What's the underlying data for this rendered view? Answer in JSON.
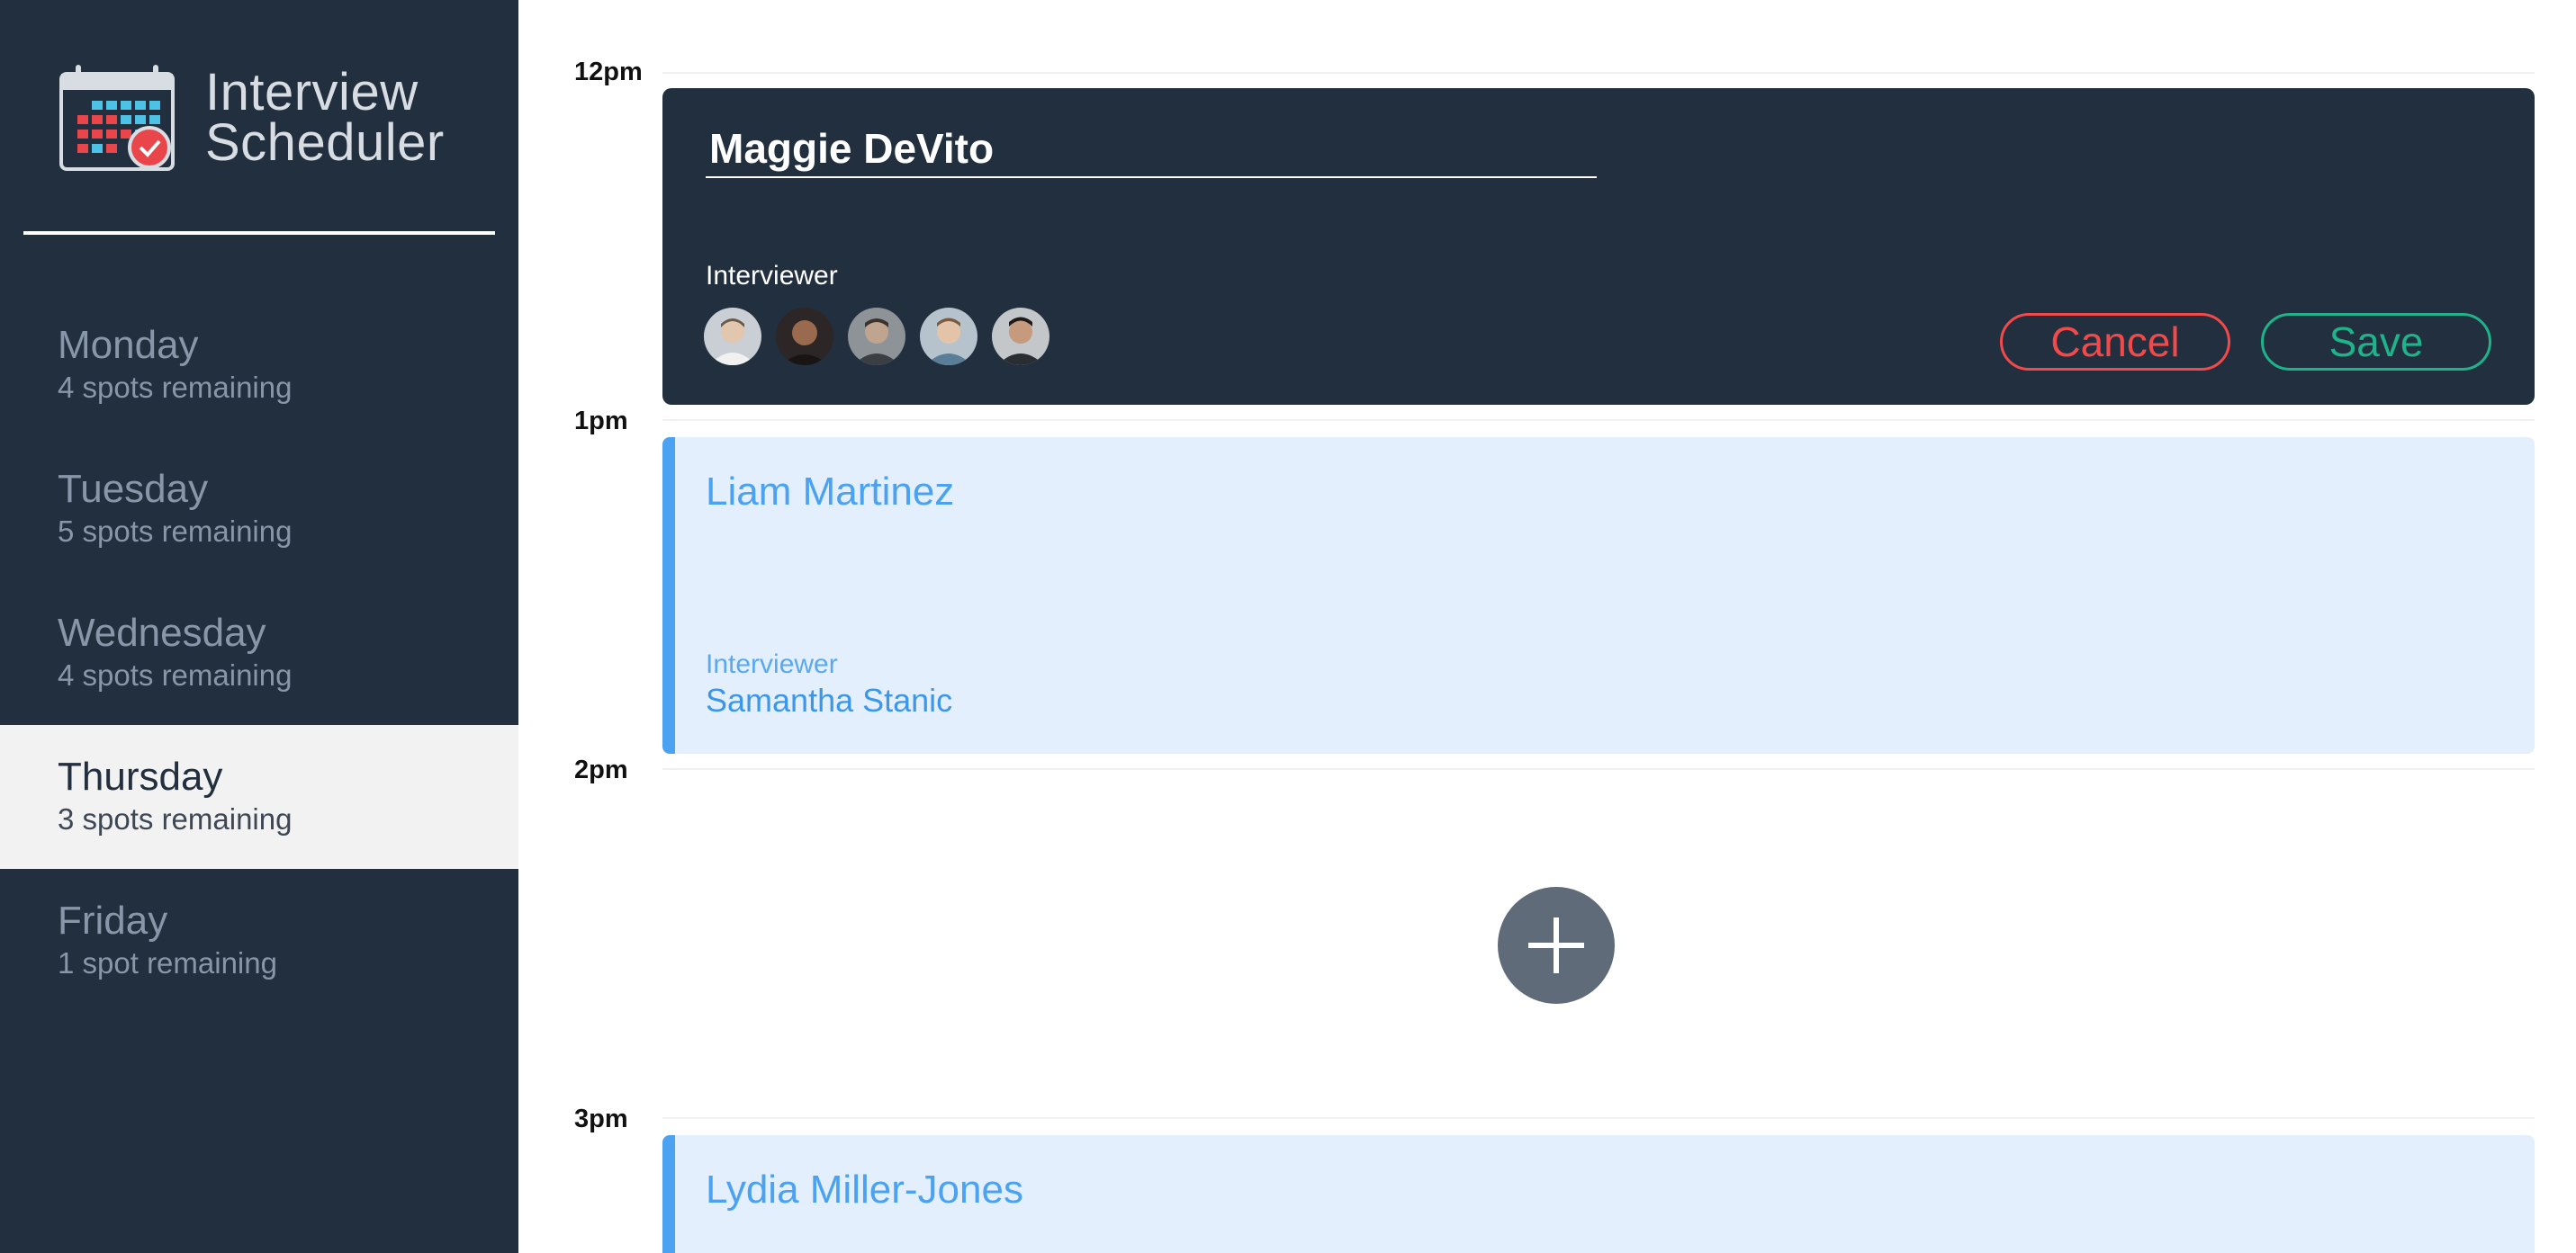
{
  "brand": {
    "title_line1": "Interview",
    "title_line2": "Scheduler"
  },
  "days": [
    {
      "name": "Monday",
      "spots": "4 spots remaining",
      "selected": false
    },
    {
      "name": "Tuesday",
      "spots": "5 spots remaining",
      "selected": false
    },
    {
      "name": "Wednesday",
      "spots": "4 spots remaining",
      "selected": false
    },
    {
      "name": "Thursday",
      "spots": "3 spots remaining",
      "selected": true
    },
    {
      "name": "Friday",
      "spots": "1 spot remaining",
      "selected": false
    }
  ],
  "hours": [
    "12pm",
    "1pm",
    "2pm",
    "3pm"
  ],
  "edit_form": {
    "student_name": "Maggie DeVito",
    "interviewer_heading": "Interviewer",
    "cancel_label": "Cancel",
    "save_label": "Save"
  },
  "appointments": [
    {
      "student": "Liam Martinez",
      "interviewer_label": "Interviewer",
      "interviewer": "Samantha Stanic"
    },
    {
      "student": "Lydia Miller-Jones"
    }
  ],
  "colors": {
    "sidebar_bg": "#222f3e",
    "selected_day_bg": "#f2f2f2",
    "appointment_bg": "#e3effc",
    "appointment_accent": "#4aa2f0",
    "cancel": "#f24a4a",
    "save": "#20b28a"
  }
}
